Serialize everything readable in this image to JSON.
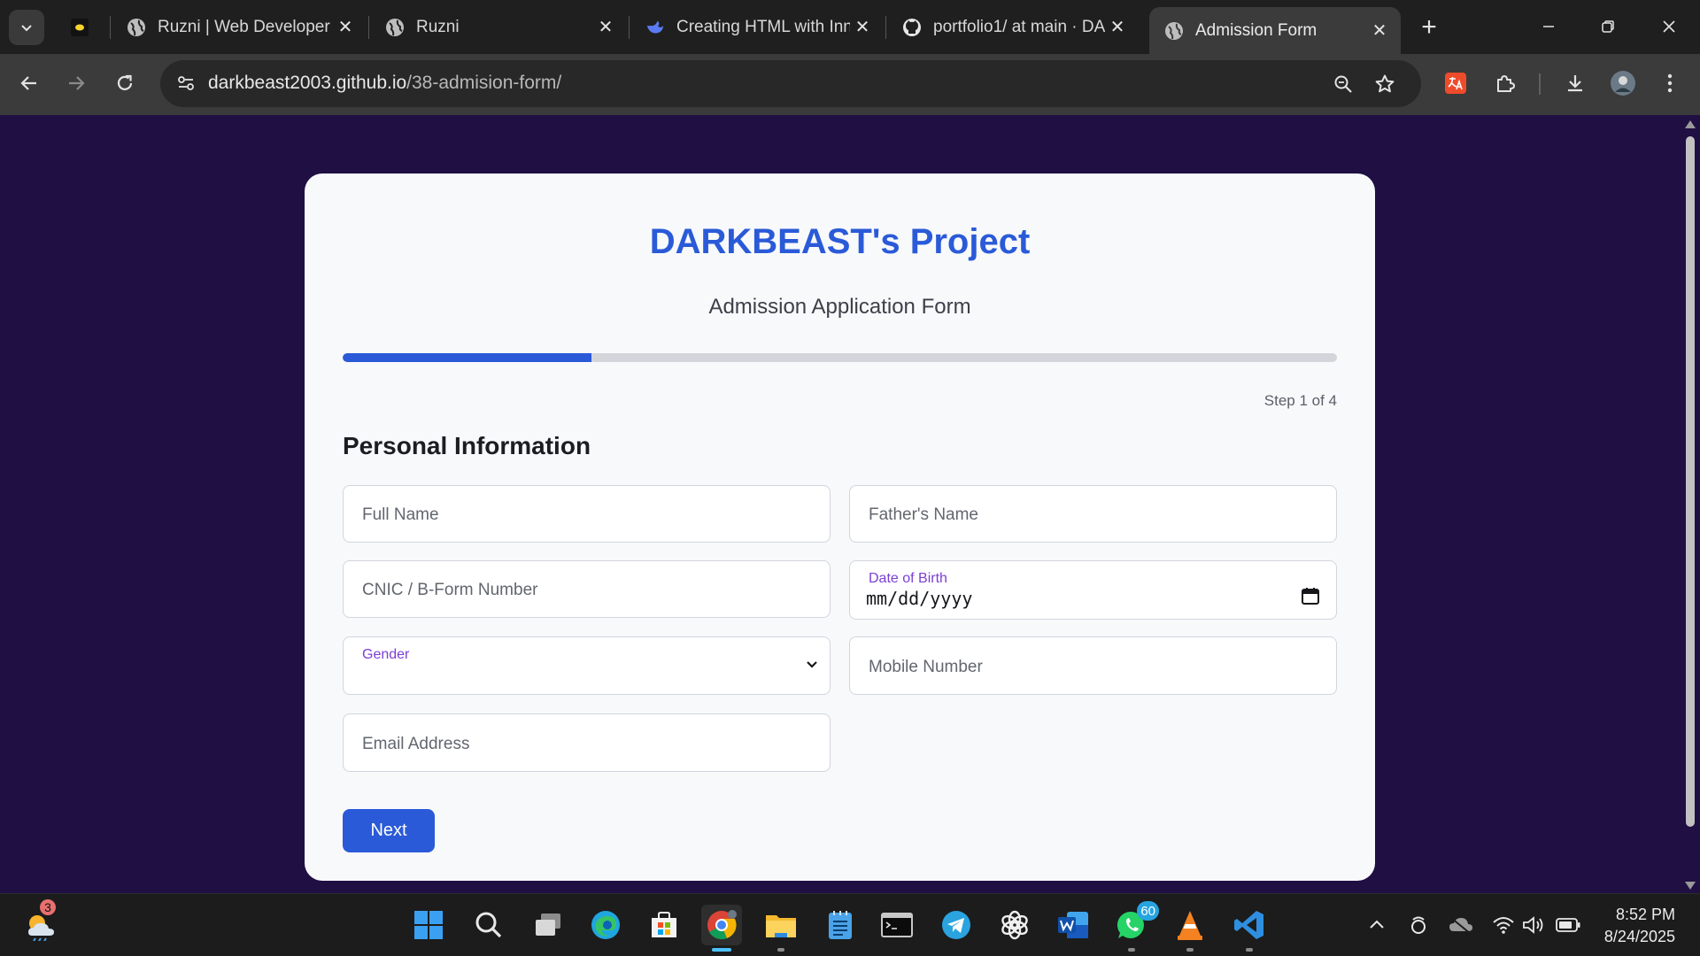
{
  "browser": {
    "tabs": [
      {
        "title": "",
        "favicon": "yellow-dot-icon"
      },
      {
        "title": "Ruzni | Web Developer",
        "favicon": "globe-icon"
      },
      {
        "title": "Ruzni",
        "favicon": "globe-icon"
      },
      {
        "title": "Creating HTML with Inn",
        "favicon": "deepseek-whale-icon"
      },
      {
        "title": "portfolio1/ at main · DA",
        "favicon": "github-icon"
      },
      {
        "title": "Admission Form",
        "favicon": "globe-icon",
        "active": true
      }
    ],
    "url_host": "darkbeast2003.github.io",
    "url_path": "/38-admision-form/"
  },
  "page": {
    "project_title": "DARKBEAST's Project",
    "subtitle": "Admission Application Form",
    "progress_fraction": 0.25,
    "step_label": "Step 1 of 4",
    "section_title": "Personal Information",
    "fields": {
      "full_name_placeholder": "Full Name",
      "father_name_placeholder": "Father's Name",
      "cnic_placeholder": "CNIC / B-Form Number",
      "dob_label": "Date of Birth",
      "dob_value": "mm/dd/yyyy",
      "gender_label": "Gender",
      "gender_value": "",
      "mobile_placeholder": "Mobile Number",
      "email_placeholder": "Email Address"
    },
    "next_label": "Next"
  },
  "taskbar": {
    "weather_badge": "3",
    "whatsapp_badge": "60",
    "time": "8:52 PM",
    "date": "8/24/2025"
  },
  "colors": {
    "page_background": "#1f0f43",
    "accent": "#2a5ad8",
    "label_purple": "#7b3fd4"
  }
}
